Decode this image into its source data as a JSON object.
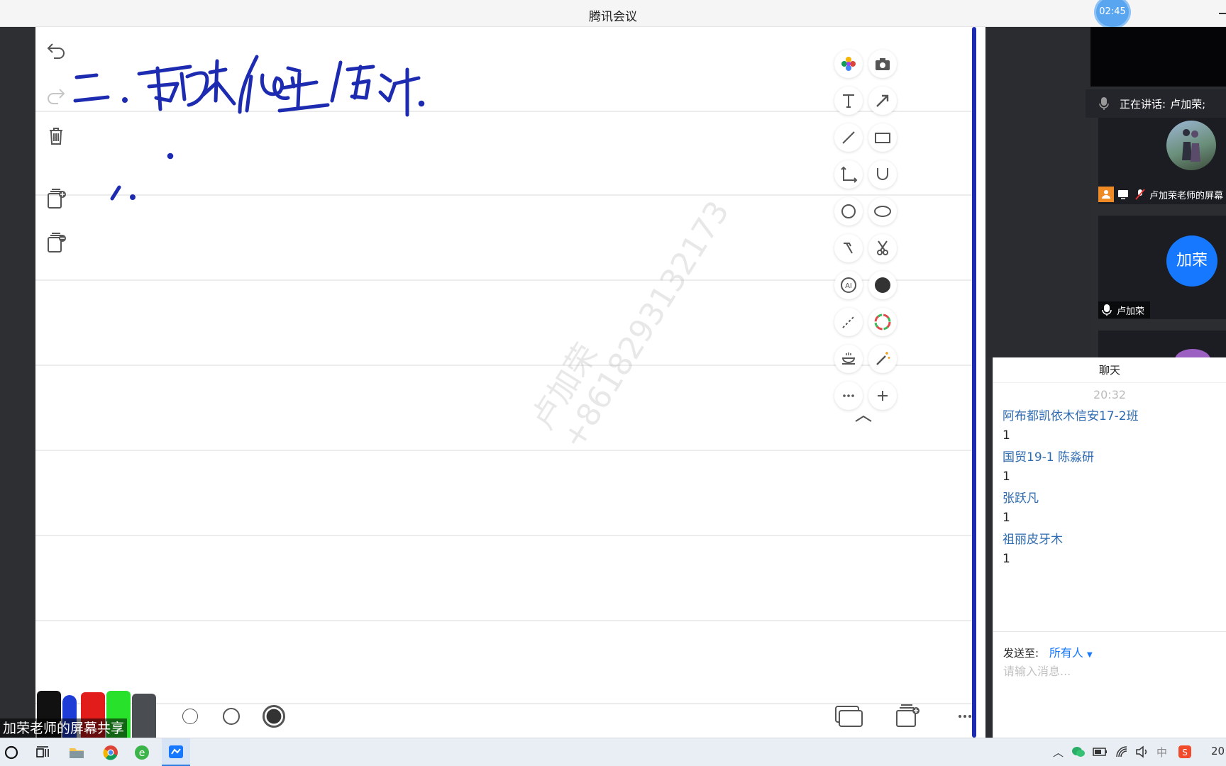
{
  "app": {
    "title": "腾讯会议",
    "timer": "02:45"
  },
  "whiteboard": {
    "watermark_name": "卢加荣",
    "watermark_phone": "+8618293132173",
    "pen_colors": [
      "#111111",
      "#1e3dd6",
      "#e21b1b",
      "#27e12a",
      "#4a4d52"
    ]
  },
  "share_caption": "加荣老师的屏幕共享",
  "video": {
    "speaking_prefix": "正在讲话:",
    "speaking_name": "卢加荣;",
    "tile1_label": "卢加荣老师的屏幕",
    "tile2_avatar": "加荣",
    "tile2_name": "卢加荣"
  },
  "chat": {
    "title": "聊天",
    "time": "20:32",
    "messages": [
      {
        "name": "阿布都凯依木信安17-2班",
        "text": "1"
      },
      {
        "name": "国贸19-1 陈淼研",
        "text": "1"
      },
      {
        "name": "张跃凡",
        "text": "1"
      },
      {
        "name": "祖丽皮牙木",
        "text": "1"
      }
    ],
    "send_to_label": "发送至:",
    "send_to_value": "所有人",
    "input_placeholder": "请输入消息..."
  },
  "taskbar": {
    "ime": "中",
    "clock": "20"
  },
  "colors": {
    "ink": "#1d2bb0",
    "accent": "#1677ff",
    "chat_name": "#2e6bb0"
  }
}
